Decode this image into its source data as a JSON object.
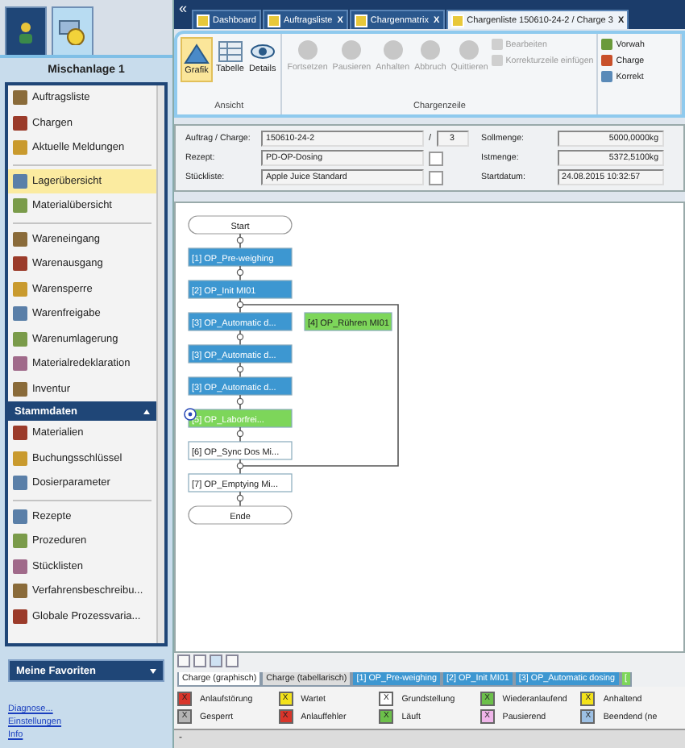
{
  "sidebar": {
    "top_tabs": [
      {
        "selected": false
      },
      {
        "selected": true
      }
    ],
    "title": "Mischanlage 1",
    "groups": [
      [
        {
          "label": "Auftragsliste",
          "selected": false
        },
        {
          "label": "Chargen",
          "selected": false
        },
        {
          "label": "Aktuelle Meldungen",
          "selected": false
        }
      ],
      [
        {
          "label": "Lagerübersicht",
          "selected": true
        },
        {
          "label": "Materialübersicht",
          "selected": false
        }
      ],
      [
        {
          "label": "Wareneingang",
          "selected": false
        },
        {
          "label": "Warenausgang",
          "selected": false
        },
        {
          "label": "Warensperre",
          "selected": false
        },
        {
          "label": "Warenfreigabe",
          "selected": false
        },
        {
          "label": "Warenumlagerung",
          "selected": false
        },
        {
          "label": "Materialredeklaration",
          "selected": false
        },
        {
          "label": "Inventur",
          "selected": false
        }
      ]
    ],
    "stammdaten": {
      "title": "Stammdaten",
      "expanded": true,
      "groups": [
        [
          {
            "label": "Materialien",
            "selected": false
          },
          {
            "label": "Buchungsschlüssel",
            "selected": false
          },
          {
            "label": "Dosierparameter",
            "selected": false
          }
        ],
        [
          {
            "label": "Rezepte",
            "selected": false
          },
          {
            "label": "Prozeduren",
            "selected": false
          },
          {
            "label": "Stücklisten",
            "selected": false
          },
          {
            "label": "Verfahrensbeschreibu...",
            "selected": false
          },
          {
            "label": "Globale Prozessvaria...",
            "selected": false
          }
        ]
      ]
    },
    "favorites": {
      "title": "Meine Favoriten",
      "expanded": false
    },
    "links": [
      "Diagnose...",
      "Einstellungen",
      "Info"
    ]
  },
  "collapse_glyph": "«",
  "doc_tabs": [
    {
      "label": "Dashboard",
      "selected": false
    },
    {
      "label": "Auftragsliste",
      "selected": false,
      "close": "X"
    },
    {
      "label": "Chargenmatrix",
      "selected": false,
      "close": "X"
    },
    {
      "label": "Chargenliste 150610-24-2 / Charge 3",
      "selected": true,
      "close": "X"
    }
  ],
  "ribbon": {
    "view_group": {
      "title": "Ansicht",
      "buttons": [
        {
          "label": "Grafik",
          "selected": true
        },
        {
          "label": "Tabelle",
          "selected": false
        },
        {
          "label": "Details",
          "selected": false
        }
      ]
    },
    "batch_group": {
      "title": "Chargenzeile",
      "buttons": [
        {
          "label": "Fortsetzen",
          "disabled": true
        },
        {
          "label": "Pausieren",
          "disabled": true
        },
        {
          "label": "Anhalten",
          "disabled": true
        },
        {
          "label": "Abbruch",
          "disabled": true
        },
        {
          "label": "Quittieren",
          "disabled": true
        }
      ],
      "small_buttons": [
        {
          "label": "Bearbeiten",
          "disabled": true
        },
        {
          "label": "Korrekturzeile einfügen",
          "disabled": true
        }
      ]
    },
    "extra_group": {
      "buttons": [
        {
          "label": "Vorwah"
        },
        {
          "label": "Charge"
        },
        {
          "label": "Korrekt"
        }
      ]
    }
  },
  "form": {
    "left": [
      {
        "label": "Auftrag / Charge:",
        "value": "150610-24-2",
        "separator": "/",
        "extra": "3"
      },
      {
        "label": "Rezept:",
        "value": "PD-OP-Dosing",
        "lookup": true
      },
      {
        "label": "Stückliste:",
        "value": "Apple Juice Standard",
        "lookup": true
      }
    ],
    "right": [
      {
        "label": "Sollmenge:",
        "value": "5000,0000kg",
        "kind": "quantity"
      },
      {
        "label": "Istmenge:",
        "value": "5372,5100kg",
        "kind": "quantity"
      },
      {
        "label": "Startdatum:",
        "value": "24.08.2015 10:32:57",
        "kind": "date"
      }
    ]
  },
  "flow": {
    "steps": [
      {
        "kind": "terminal",
        "label": "Start"
      },
      {
        "kind": "step",
        "label": "[1] OP_Pre-weighing",
        "color": "#3d97d1"
      },
      {
        "kind": "step",
        "label": "[2] OP_Init MI01",
        "color": "#3d97d1"
      },
      {
        "kind": "step",
        "label": "[3] OP_Automatic d...",
        "color": "#3d97d1"
      },
      {
        "kind": "branch",
        "label": "[4] OP_Rühren MI01",
        "color": "#7dd65a"
      },
      {
        "kind": "step",
        "label": "[3] OP_Automatic d...",
        "color": "#3d97d1"
      },
      {
        "kind": "step",
        "label": "[3] OP_Automatic d...",
        "color": "#3d97d1"
      },
      {
        "kind": "step",
        "label": "[5] OP_Laborfrei...",
        "color": "#7dd65a",
        "info_marker": true
      },
      {
        "kind": "step",
        "label": "[6] OP_Sync Dos Mi..."
      },
      {
        "kind": "join"
      },
      {
        "kind": "step",
        "label": "[7] OP_Emptying Mi..."
      },
      {
        "kind": "terminal",
        "label": "Ende"
      }
    ]
  },
  "sheet_tabs": [
    {
      "kind": "view",
      "label": "Charge (graphisch)",
      "selected": true
    },
    {
      "kind": "view",
      "label": "Charge (tabellarisch)",
      "selected": false
    },
    {
      "kind": "step",
      "label": "[1] OP_Pre-weighing",
      "color": "#3d97d1",
      "selected": false
    },
    {
      "kind": "step",
      "label": "[2] OP_Init MI01",
      "color": "#3d97d1",
      "selected": false
    },
    {
      "kind": "step",
      "label": "[3] OP_Automatic dosing",
      "color": "#3d97d1",
      "selected": false
    },
    {
      "kind": "step",
      "label": "[",
      "color": "#7dd65a",
      "selected": false
    }
  ],
  "legend": [
    {
      "symbol": "X",
      "label": "Anlaufstörung",
      "color": "#d8352a"
    },
    {
      "symbol": "X",
      "label": "Wartet",
      "color": "#f3e21a"
    },
    {
      "symbol": "X",
      "label": "Grundstellung",
      "color": "#ffffff"
    },
    {
      "symbol": "X",
      "label": "Wiederanlaufend",
      "color": "#6cc04a"
    },
    {
      "symbol": "X",
      "label": "Anhaltend",
      "color": "#f3e21a"
    },
    {
      "symbol": "X",
      "label": "Gesperrt",
      "color": "#b4b4b4"
    },
    {
      "symbol": "X",
      "label": "Anlauffehler",
      "color": "#d8352a"
    },
    {
      "symbol": "X",
      "label": "Läuft",
      "color": "#6cc04a"
    },
    {
      "symbol": "X",
      "label": "Pausierend",
      "color": "#f0b6ea"
    },
    {
      "symbol": "X",
      "label": "Beendend (ne",
      "color": "#9dc0e4"
    }
  ],
  "status_bar": "-"
}
